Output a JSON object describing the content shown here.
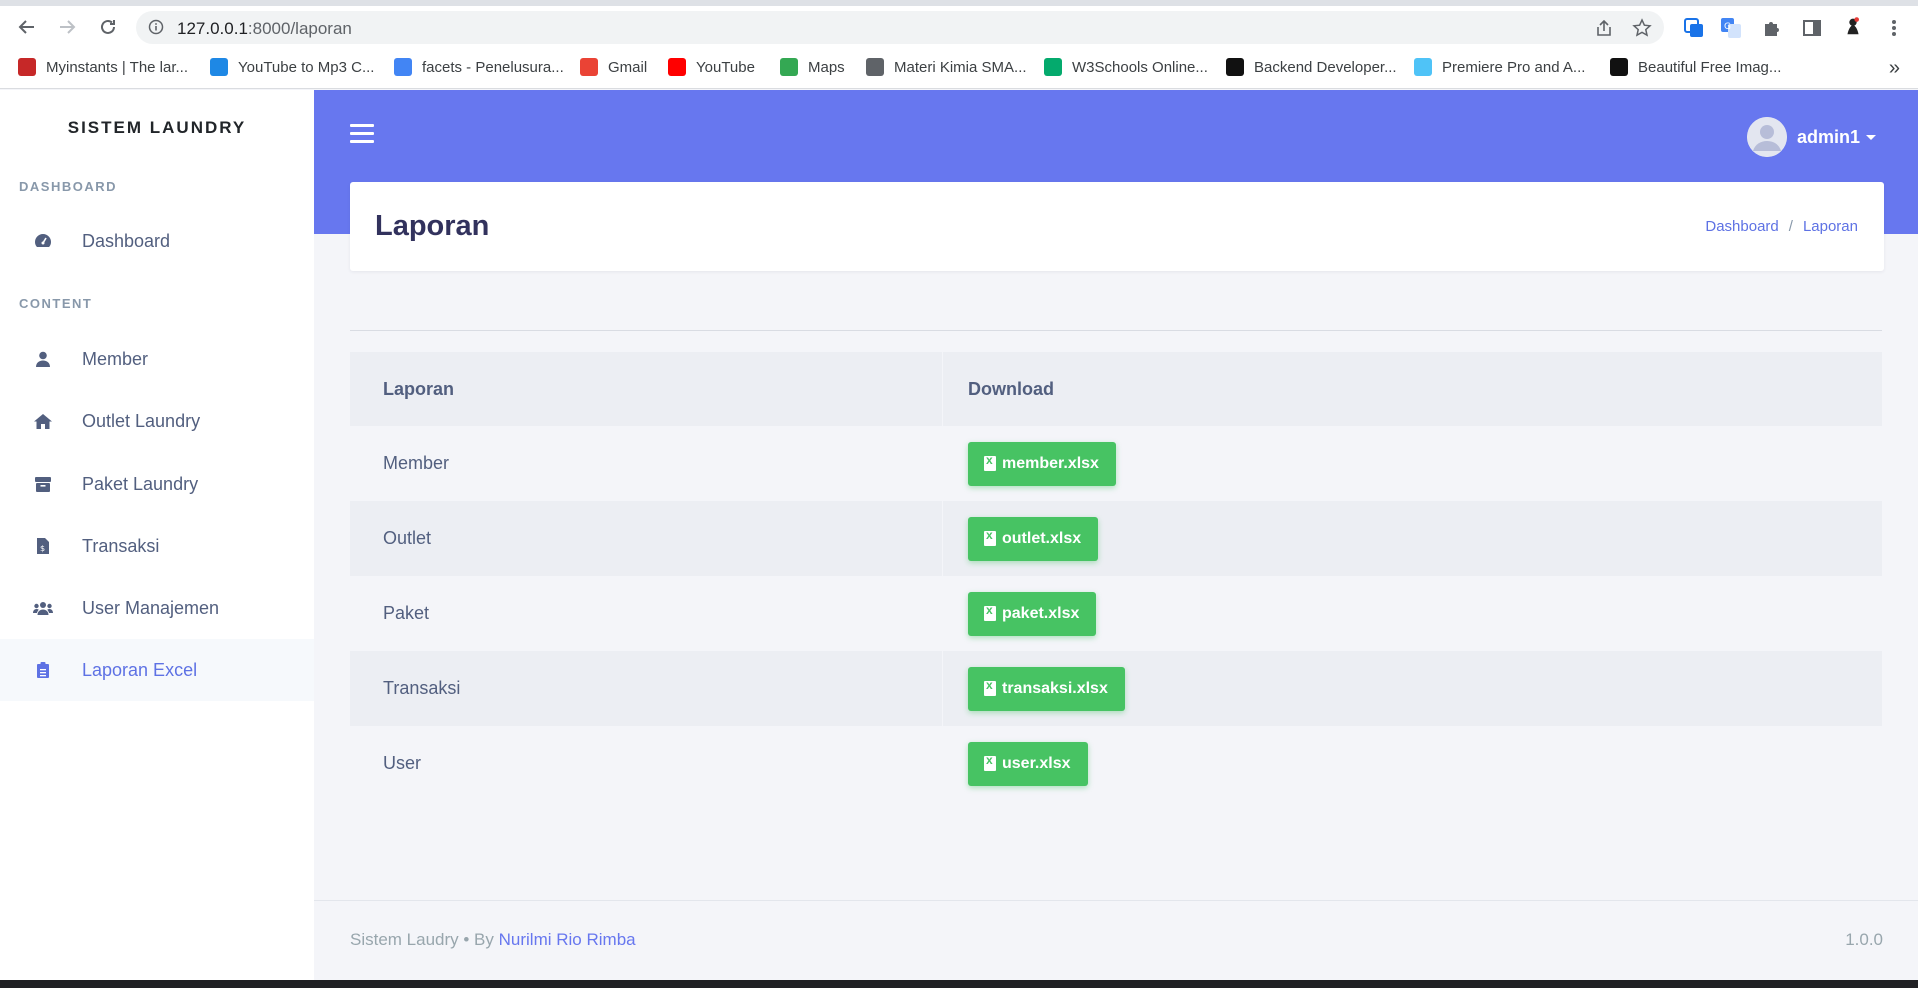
{
  "browser": {
    "url_host": "127.0.0.1",
    "url_path": ":8000/laporan",
    "bookmarks": [
      {
        "label": "Myinstants | The lar...",
        "color": "#c62828"
      },
      {
        "label": "YouTube to Mp3 C...",
        "color": "#1e88e5"
      },
      {
        "label": "facets - Penelusura...",
        "color": "#4285f4"
      },
      {
        "label": "Gmail",
        "color": "#ea4335"
      },
      {
        "label": "YouTube",
        "color": "#ff0000"
      },
      {
        "label": "Maps",
        "color": "#34a853"
      },
      {
        "label": "Materi Kimia SMA...",
        "color": "#5f6368"
      },
      {
        "label": "W3Schools Online...",
        "color": "#04aa6d"
      },
      {
        "label": "Backend Developer...",
        "color": "#111111"
      },
      {
        "label": "Premiere Pro and A...",
        "color": "#4fc3f7"
      },
      {
        "label": "Beautiful Free Imag...",
        "color": "#111111"
      }
    ],
    "more": "»"
  },
  "sidebar": {
    "brand": "SISTEM LAUNDRY",
    "heading_dashboard": "DASHBOARD",
    "heading_content": "CONTENT",
    "items": [
      {
        "label": "Dashboard",
        "icon": "tachometer-icon"
      },
      {
        "label": "Member",
        "icon": "user-icon"
      },
      {
        "label": "Outlet Laundry",
        "icon": "home-icon"
      },
      {
        "label": "Paket Laundry",
        "icon": "box-icon"
      },
      {
        "label": "Transaksi",
        "icon": "file-invoice-icon"
      },
      {
        "label": "User Manajemen",
        "icon": "users-icon"
      },
      {
        "label": "Laporan Excel",
        "icon": "clipboard-icon",
        "active": true
      }
    ]
  },
  "header": {
    "user_name": "admin1"
  },
  "page": {
    "title": "Laporan",
    "breadcrumb": [
      "Dashboard",
      "Laporan"
    ],
    "breadcrumb_sep": "/"
  },
  "table": {
    "columns": [
      "Laporan",
      "Download"
    ],
    "rows": [
      {
        "name": "Member",
        "file": "member.xlsx"
      },
      {
        "name": "Outlet",
        "file": "outlet.xlsx"
      },
      {
        "name": "Paket",
        "file": "paket.xlsx"
      },
      {
        "name": "Transaksi",
        "file": "transaksi.xlsx"
      },
      {
        "name": "User",
        "file": "user.xlsx"
      }
    ]
  },
  "footer": {
    "prefix": "Sistem Laudry • By",
    "author": "Nurilmi Rio Rimba",
    "version": "1.0.0"
  },
  "colors": {
    "primary": "#6777ef",
    "success": "#47c363",
    "active_link": "#5e72e4"
  }
}
